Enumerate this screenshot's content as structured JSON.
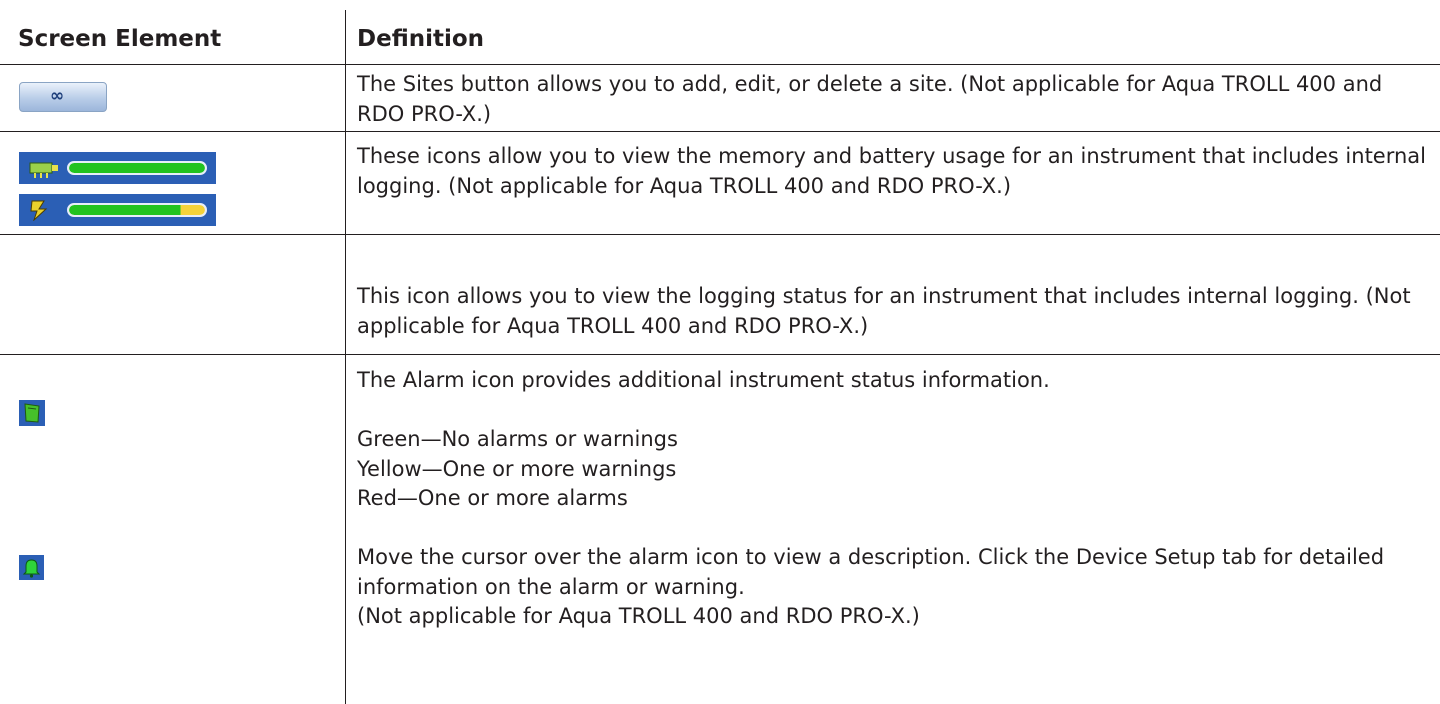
{
  "header": {
    "col1": "Screen Element",
    "col2": "Definition"
  },
  "rows": [
    {
      "icon": "sites-button-icon",
      "definition": "The Sites button allows you to add, edit, or delete a site. (Not applicable for Aqua TROLL 400 and RDO PRO-X.)"
    },
    {
      "icon": "memory-battery-icons",
      "memory_level": 1.0,
      "battery_level": 0.82,
      "colors": {
        "bar_bg": "#2b5fb5",
        "fill_green": "#22c31f",
        "fill_yellow": "#f3d23a"
      },
      "definition": "These icons allow you to view the memory and battery usage for an instrument that includes internal logging. (Not applicable for Aqua TROLL 400 and RDO PRO-X.)"
    },
    {
      "icon": "logging-status-icon",
      "definition": "This icon allows you to view the logging status for an instrument that includes internal logging. (Not applicable for Aqua TROLL 400 and RDO PRO-X.)"
    },
    {
      "icon": "alarm-bell-icon",
      "definition_lines": [
        "The Alarm icon provides additional instrument status information.",
        "",
        "Green—No alarms or warnings",
        "Yellow—One or more warnings",
        "Red—One or more alarms",
        "",
        "Move the cursor over the alarm icon to view a description. Click the Device Setup tab for detailed information on the alarm or warning.",
        "(Not applicable for Aqua TROLL 400 and RDO PRO-X.)"
      ]
    }
  ]
}
